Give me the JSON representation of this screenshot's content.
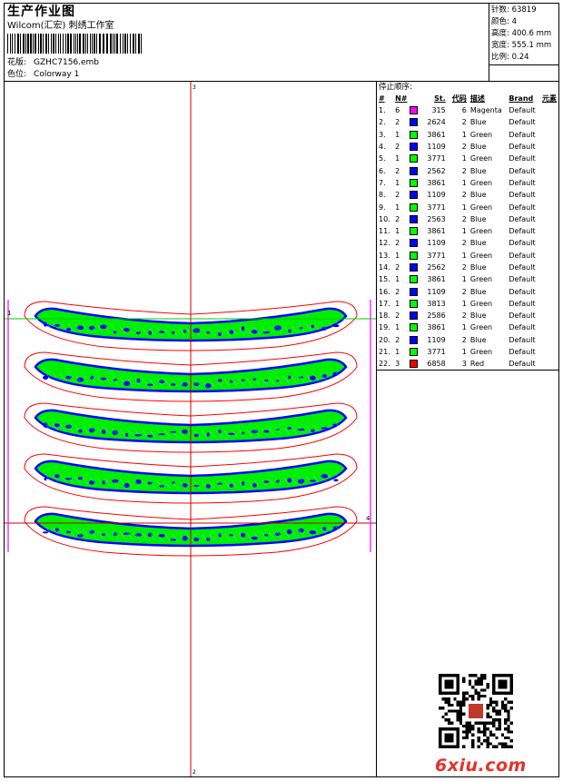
{
  "header": {
    "title": "生产作业图",
    "studio": "Wilcom(汇宏) 刺绣工作室",
    "design_label": "花版:",
    "design_value": "GZHC7156.emb",
    "colorway_label": "色位:",
    "colorway_value": "Colorway 1"
  },
  "stats": [
    {
      "label": "针数:",
      "value": "63819"
    },
    {
      "label": "颜色:",
      "value": "4"
    },
    {
      "label": "高度:",
      "value": "400.6 mm"
    },
    {
      "label": "宽度:",
      "value": "555.1 mm"
    },
    {
      "label": "比例:",
      "value": "0.24"
    }
  ],
  "sequence": {
    "title": "停止顺序:",
    "columns": [
      "#",
      "N#",
      "St.",
      "代码",
      "描述",
      "Brand",
      "元素"
    ],
    "rows": [
      {
        "idx": "1.",
        "n": "6",
        "color": "#ff00ff",
        "st": "315",
        "code": "6",
        "desc": "Magenta",
        "brand": "Default"
      },
      {
        "idx": "2.",
        "n": "2",
        "color": "#0000ff",
        "st": "2624",
        "code": "2",
        "desc": "Blue",
        "brand": "Default"
      },
      {
        "idx": "3.",
        "n": "1",
        "color": "#00ff00",
        "st": "3861",
        "code": "1",
        "desc": "Green",
        "brand": "Default"
      },
      {
        "idx": "4.",
        "n": "2",
        "color": "#0000ff",
        "st": "1109",
        "code": "2",
        "desc": "Blue",
        "brand": "Default"
      },
      {
        "idx": "5.",
        "n": "1",
        "color": "#00ff00",
        "st": "3771",
        "code": "1",
        "desc": "Green",
        "brand": "Default"
      },
      {
        "idx": "6.",
        "n": "2",
        "color": "#0000ff",
        "st": "2562",
        "code": "2",
        "desc": "Blue",
        "brand": "Default"
      },
      {
        "idx": "7.",
        "n": "1",
        "color": "#00ff00",
        "st": "3861",
        "code": "1",
        "desc": "Green",
        "brand": "Default"
      },
      {
        "idx": "8.",
        "n": "2",
        "color": "#0000ff",
        "st": "1109",
        "code": "2",
        "desc": "Blue",
        "brand": "Default"
      },
      {
        "idx": "9.",
        "n": "1",
        "color": "#00ff00",
        "st": "3771",
        "code": "1",
        "desc": "Green",
        "brand": "Default"
      },
      {
        "idx": "10.",
        "n": "2",
        "color": "#0000ff",
        "st": "2563",
        "code": "2",
        "desc": "Blue",
        "brand": "Default"
      },
      {
        "idx": "11.",
        "n": "1",
        "color": "#00ff00",
        "st": "3861",
        "code": "1",
        "desc": "Green",
        "brand": "Default"
      },
      {
        "idx": "12.",
        "n": "2",
        "color": "#0000ff",
        "st": "1109",
        "code": "2",
        "desc": "Blue",
        "brand": "Default"
      },
      {
        "idx": "13.",
        "n": "1",
        "color": "#00ff00",
        "st": "3771",
        "code": "1",
        "desc": "Green",
        "brand": "Default"
      },
      {
        "idx": "14.",
        "n": "2",
        "color": "#0000ff",
        "st": "2562",
        "code": "2",
        "desc": "Blue",
        "brand": "Default"
      },
      {
        "idx": "15.",
        "n": "1",
        "color": "#00ff00",
        "st": "3861",
        "code": "1",
        "desc": "Green",
        "brand": "Default"
      },
      {
        "idx": "16.",
        "n": "2",
        "color": "#0000ff",
        "st": "1109",
        "code": "2",
        "desc": "Blue",
        "brand": "Default"
      },
      {
        "idx": "17.",
        "n": "1",
        "color": "#00ff00",
        "st": "3813",
        "code": "1",
        "desc": "Green",
        "brand": "Default"
      },
      {
        "idx": "18.",
        "n": "2",
        "color": "#0000ff",
        "st": "2586",
        "code": "2",
        "desc": "Blue",
        "brand": "Default"
      },
      {
        "idx": "19.",
        "n": "1",
        "color": "#00ff00",
        "st": "3861",
        "code": "1",
        "desc": "Green",
        "brand": "Default"
      },
      {
        "idx": "20.",
        "n": "2",
        "color": "#0000ff",
        "st": "1109",
        "code": "2",
        "desc": "Blue",
        "brand": "Default"
      },
      {
        "idx": "21.",
        "n": "1",
        "color": "#00ff00",
        "st": "3771",
        "code": "1",
        "desc": "Green",
        "brand": "Default"
      },
      {
        "idx": "22.",
        "n": "3",
        "color": "#ff0000",
        "st": "6858",
        "code": "3",
        "desc": "Red",
        "brand": "Default"
      }
    ]
  },
  "design": {
    "axis_marker_left": "1",
    "axis_marker_right": "4",
    "axis_marker_top": "3",
    "axis_marker_bottom": "2",
    "colors": {
      "outline": "#ff0000",
      "fill": "#00ee00",
      "detail": "#0000ff",
      "guide": "#c00000",
      "baseline": "#00cc00",
      "frame": "#ff00ff"
    }
  },
  "watermark": "6xiu.com"
}
